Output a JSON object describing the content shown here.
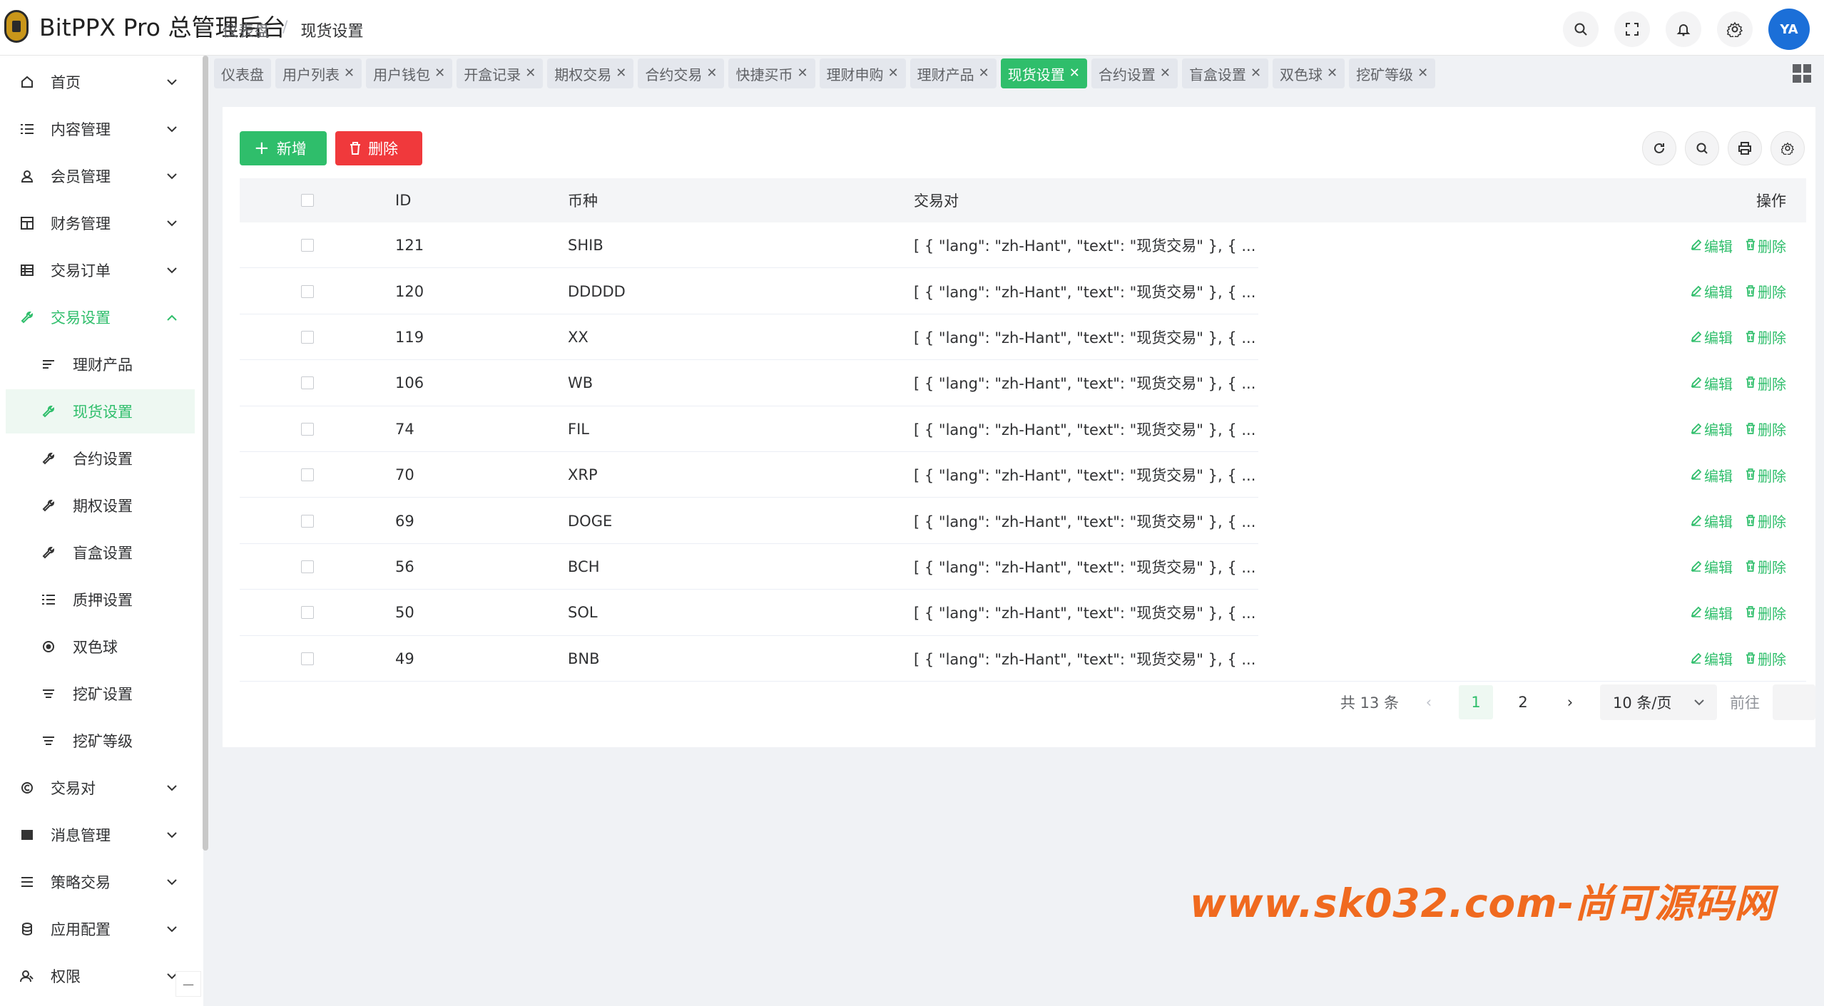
{
  "header": {
    "app_title": "BitPPX Pro 总管理后台",
    "breadcrumb": [
      "仪表盘",
      "/",
      "现货设置"
    ],
    "avatar_text": "YA"
  },
  "sidebar": {
    "items": [
      {
        "label": "首页",
        "icon": "home-icon"
      },
      {
        "label": "内容管理",
        "icon": "list-icon"
      },
      {
        "label": "会员管理",
        "icon": "user-icon"
      },
      {
        "label": "财务管理",
        "icon": "grid-icon"
      },
      {
        "label": "交易订单",
        "icon": "table-icon"
      },
      {
        "label": "交易设置",
        "icon": "wrench-icon"
      },
      {
        "label": "理财产品",
        "icon": "lines-icon"
      },
      {
        "label": "现货设置",
        "icon": "wrench-icon"
      },
      {
        "label": "合约设置",
        "icon": "wrench-icon"
      },
      {
        "label": "期权设置",
        "icon": "wrench-icon"
      },
      {
        "label": "盲盒设置",
        "icon": "wrench-icon"
      },
      {
        "label": "质押设置",
        "icon": "list-icon"
      },
      {
        "label": "双色球",
        "icon": "radio-icon"
      },
      {
        "label": "挖矿设置",
        "icon": "lines-icon"
      },
      {
        "label": "挖矿等级",
        "icon": "lines-icon"
      },
      {
        "label": "交易对",
        "icon": "copyright-icon"
      },
      {
        "label": "消息管理",
        "icon": "mail-icon"
      },
      {
        "label": "策略交易",
        "icon": "menu-icon"
      },
      {
        "label": "应用配置",
        "icon": "coins-icon"
      },
      {
        "label": "权限",
        "icon": "user-group-icon"
      }
    ],
    "collapse_glyph": "—"
  },
  "tabs": [
    "仪表盘",
    "用户列表",
    "用户钱包",
    "开盒记录",
    "期权交易",
    "合约交易",
    "快捷买币",
    "理财申购",
    "理财产品",
    "现货设置",
    "合约设置",
    "盲盒设置",
    "双色球",
    "挖矿等级"
  ],
  "active_tab": "现货设置",
  "toolbar": {
    "add_label": "新增",
    "delete_label": "删除"
  },
  "table": {
    "headers": {
      "id": "ID",
      "coin": "币种",
      "pair": "交易对",
      "actions": "操作"
    },
    "rows": [
      {
        "id": "121",
        "coin": "SHIB",
        "pair": "[ { \"lang\": \"zh-Hant\", \"text\": \"现货交易\" }, { ..."
      },
      {
        "id": "120",
        "coin": "DDDDD",
        "pair": "[ { \"lang\": \"zh-Hant\", \"text\": \"现货交易\" }, { ..."
      },
      {
        "id": "119",
        "coin": "XX",
        "pair": "[ { \"lang\": \"zh-Hant\", \"text\": \"现货交易\" }, { ..."
      },
      {
        "id": "106",
        "coin": "WB",
        "pair": "[ { \"lang\": \"zh-Hant\", \"text\": \"现货交易\" }, { ..."
      },
      {
        "id": "74",
        "coin": "FIL",
        "pair": "[ { \"lang\": \"zh-Hant\", \"text\": \"现货交易\" }, { ..."
      },
      {
        "id": "70",
        "coin": "XRP",
        "pair": "[ { \"lang\": \"zh-Hant\", \"text\": \"现货交易\" }, { ..."
      },
      {
        "id": "69",
        "coin": "DOGE",
        "pair": "[ { \"lang\": \"zh-Hant\", \"text\": \"现货交易\" }, { ..."
      },
      {
        "id": "56",
        "coin": "BCH",
        "pair": "[ { \"lang\": \"zh-Hant\", \"text\": \"现货交易\" }, { ..."
      },
      {
        "id": "50",
        "coin": "SOL",
        "pair": "[ { \"lang\": \"zh-Hant\", \"text\": \"现货交易\" }, { ..."
      },
      {
        "id": "49",
        "coin": "BNB",
        "pair": "[ { \"lang\": \"zh-Hant\", \"text\": \"现货交易\" }, { ..."
      }
    ],
    "edit_label": "编辑",
    "delete_label": "删除"
  },
  "pagination": {
    "total": "共 13 条",
    "pages": [
      "1",
      "2"
    ],
    "current": "1",
    "page_size": "10 条/页",
    "goto_label": "前往"
  },
  "watermark": "www.sk032.com-尚可源码网",
  "colors": {
    "accent": "#2fbe6b",
    "danger": "#f0393c",
    "watermark": "#f06a1f"
  }
}
